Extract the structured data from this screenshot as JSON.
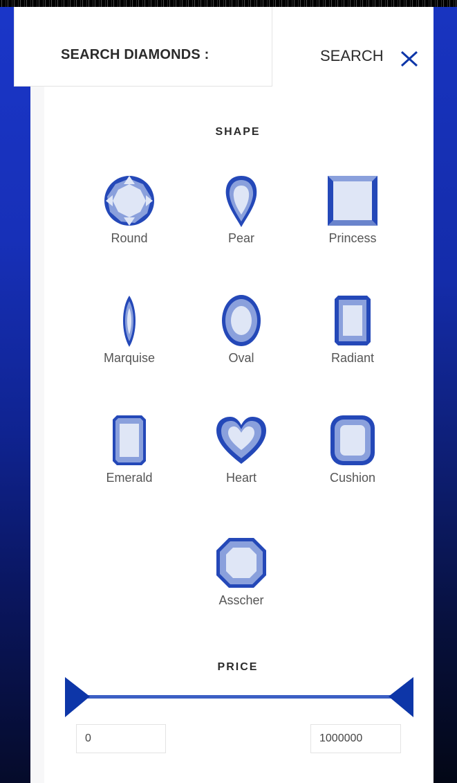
{
  "header": {
    "title": "SEARCH DIAMONDS :",
    "search_label": "SEARCH"
  },
  "shape_section": {
    "title": "SHAPE",
    "shapes": [
      {
        "label": "Round",
        "icon": "round-diamond-icon"
      },
      {
        "label": "Pear",
        "icon": "pear-diamond-icon"
      },
      {
        "label": "Princess",
        "icon": "princess-diamond-icon"
      },
      {
        "label": "Marquise",
        "icon": "marquise-diamond-icon"
      },
      {
        "label": "Oval",
        "icon": "oval-diamond-icon"
      },
      {
        "label": "Radiant",
        "icon": "radiant-diamond-icon"
      },
      {
        "label": "Emerald",
        "icon": "emerald-diamond-icon"
      },
      {
        "label": "Heart",
        "icon": "heart-diamond-icon"
      },
      {
        "label": "Cushion",
        "icon": "cushion-diamond-icon"
      },
      {
        "label": "Asscher",
        "icon": "asscher-diamond-icon"
      }
    ]
  },
  "price_section": {
    "title": "PRICE",
    "min_value": "0",
    "max_value": "1000000"
  },
  "colors": {
    "accent": "#0d36a8",
    "gem_light": "#dfe6f6",
    "gem_mid": "#8aa0dc",
    "gem_dark": "#2448b8"
  }
}
